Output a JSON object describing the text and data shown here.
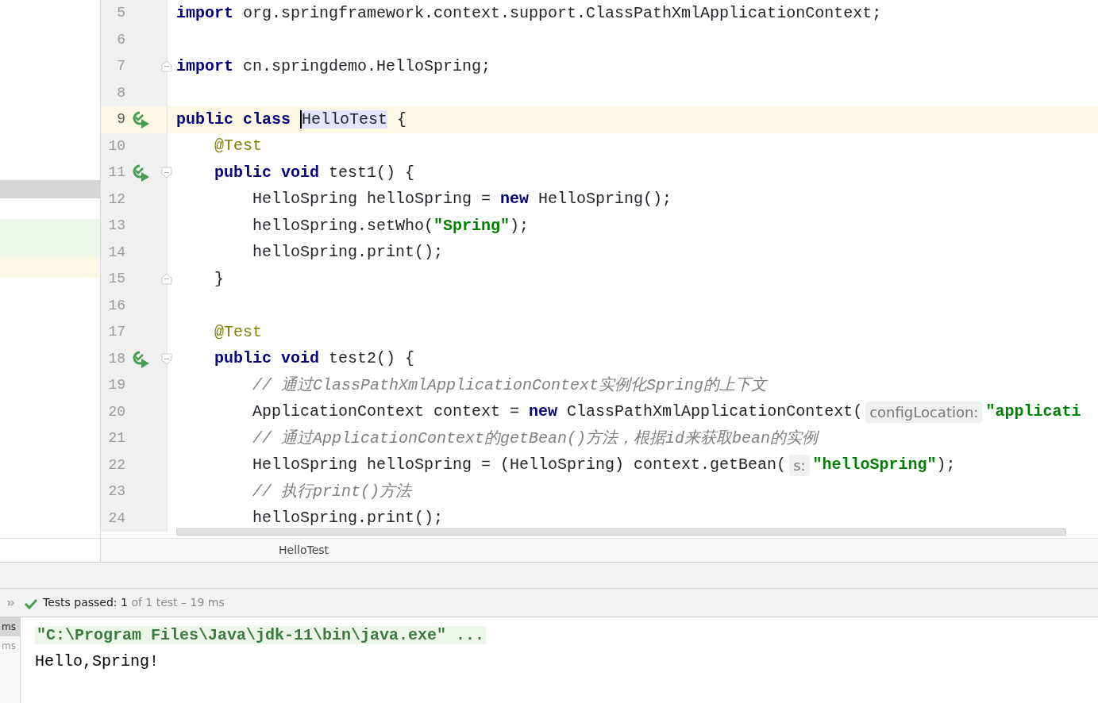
{
  "editor": {
    "lines": [
      {
        "number": "5",
        "current": false,
        "run_icon": false,
        "fold_start": false,
        "fold_end": false,
        "tokens": [
          {
            "kind": "keyword",
            "text": "import "
          },
          {
            "kind": "plain",
            "text": "org.springframework.context.support.ClassPathXmlApplicationContext;"
          }
        ]
      },
      {
        "number": "6",
        "current": false,
        "run_icon": false,
        "fold_start": false,
        "fold_end": false
      },
      {
        "number": "7",
        "current": false,
        "run_icon": false,
        "fold_start": false,
        "fold_end": true,
        "tokens": [
          {
            "kind": "keyword",
            "text": "import "
          },
          {
            "kind": "plain",
            "text": "cn.springdemo.HelloSpring;"
          }
        ]
      },
      {
        "number": "8",
        "current": false,
        "run_icon": false,
        "fold_start": false,
        "fold_end": false
      },
      {
        "number": "9",
        "current": true,
        "run_icon": true,
        "fold_start": false,
        "fold_end": false,
        "tokens": [
          {
            "kind": "keyword",
            "text": "public "
          },
          {
            "kind": "keyword",
            "text": "class "
          },
          {
            "kind": "selected",
            "text": "HelloTest"
          },
          {
            "kind": "plain",
            "text": " {"
          }
        ]
      },
      {
        "number": "10",
        "current": false,
        "run_icon": false,
        "fold_start": false,
        "fold_end": false,
        "tokens": [
          {
            "kind": "annotation",
            "text": "    @Test"
          }
        ]
      },
      {
        "number": "11",
        "current": false,
        "run_icon": true,
        "fold_start": true,
        "fold_end": false,
        "tokens": [
          {
            "kind": "keyword",
            "text": "    public "
          },
          {
            "kind": "keyword",
            "text": "void"
          },
          {
            "kind": "plain",
            "text": " test1() {"
          }
        ]
      },
      {
        "number": "12",
        "current": false,
        "run_icon": false,
        "fold_start": false,
        "fold_end": false,
        "tokens": [
          {
            "kind": "plain",
            "text": "        HelloSpring helloSpring = "
          },
          {
            "kind": "keyword",
            "text": "new"
          },
          {
            "kind": "plain",
            "text": " HelloSpring();"
          }
        ]
      },
      {
        "number": "13",
        "current": false,
        "run_icon": false,
        "fold_start": false,
        "fold_end": false,
        "tokens": [
          {
            "kind": "plain",
            "text": "        helloSpring.setWho("
          },
          {
            "kind": "string",
            "text": "\"Spring\""
          },
          {
            "kind": "plain",
            "text": ");"
          }
        ]
      },
      {
        "number": "14",
        "current": false,
        "run_icon": false,
        "fold_start": false,
        "fold_end": false,
        "tokens": [
          {
            "kind": "plain",
            "text": "        helloSpring.print();"
          }
        ]
      },
      {
        "number": "15",
        "current": false,
        "run_icon": false,
        "fold_start": false,
        "fold_end": true,
        "tokens": [
          {
            "kind": "plain",
            "text": "    }"
          }
        ]
      },
      {
        "number": "16",
        "current": false,
        "run_icon": false,
        "fold_start": false,
        "fold_end": false
      },
      {
        "number": "17",
        "current": false,
        "run_icon": false,
        "fold_start": false,
        "fold_end": false,
        "tokens": [
          {
            "kind": "annotation",
            "text": "    @Test"
          }
        ]
      },
      {
        "number": "18",
        "current": false,
        "run_icon": true,
        "fold_start": true,
        "fold_end": false,
        "tokens": [
          {
            "kind": "keyword",
            "text": "    public "
          },
          {
            "kind": "keyword",
            "text": "void"
          },
          {
            "kind": "plain",
            "text": " test2() {"
          }
        ]
      },
      {
        "number": "19",
        "current": false,
        "run_icon": false,
        "fold_start": false,
        "fold_end": false,
        "tokens": [
          {
            "kind": "comment",
            "text": "        // 通过ClassPathXmlApplicationContext实例化Spring的上下文"
          }
        ]
      },
      {
        "number": "20",
        "current": false,
        "run_icon": false,
        "fold_start": false,
        "fold_end": false,
        "tokens": [
          {
            "kind": "plain",
            "text": "        ApplicationContext context = "
          },
          {
            "kind": "keyword",
            "text": "new"
          },
          {
            "kind": "plain",
            "text": " ClassPathXmlApplicationContext("
          },
          {
            "kind": "hint",
            "text": "configLocation:"
          },
          {
            "kind": "string",
            "text": "\"applicati"
          }
        ]
      },
      {
        "number": "21",
        "current": false,
        "run_icon": false,
        "fold_start": false,
        "fold_end": false,
        "tokens": [
          {
            "kind": "comment",
            "text": "        // 通过ApplicationContext的getBean()方法，根据id来获取bean的实例"
          }
        ]
      },
      {
        "number": "22",
        "current": false,
        "run_icon": false,
        "fold_start": false,
        "fold_end": false,
        "tokens": [
          {
            "kind": "plain",
            "text": "        HelloSpring helloSpring = (HelloSpring) context.getBean("
          },
          {
            "kind": "hint",
            "text": "s:"
          },
          {
            "kind": "string",
            "text": "\"helloSpring\""
          },
          {
            "kind": "plain",
            "text": ");"
          }
        ]
      },
      {
        "number": "23",
        "current": false,
        "run_icon": false,
        "fold_start": false,
        "fold_end": false,
        "tokens": [
          {
            "kind": "comment",
            "text": "        // 执行print()方法"
          }
        ]
      },
      {
        "number": "24",
        "current": false,
        "run_icon": false,
        "fold_start": false,
        "fold_end": false,
        "tokens": [
          {
            "kind": "plain",
            "text": "        helloSpring.print();"
          }
        ]
      }
    ],
    "breadcrumb": "HelloTest"
  },
  "test_status": {
    "passed": true,
    "label": "Tests passed: 1",
    "detail": "of 1 test – 19 ms"
  },
  "console": {
    "side_items": [
      {
        "text": "ms",
        "selected": true
      },
      {
        "text": "ms",
        "selected": false
      }
    ],
    "lines": [
      {
        "kind": "command",
        "text": "\"C:\\Program Files\\Java\\jdk-11\\bin\\java.exe\" ..."
      },
      {
        "kind": "output",
        "text": "Hello,Spring!"
      }
    ]
  }
}
